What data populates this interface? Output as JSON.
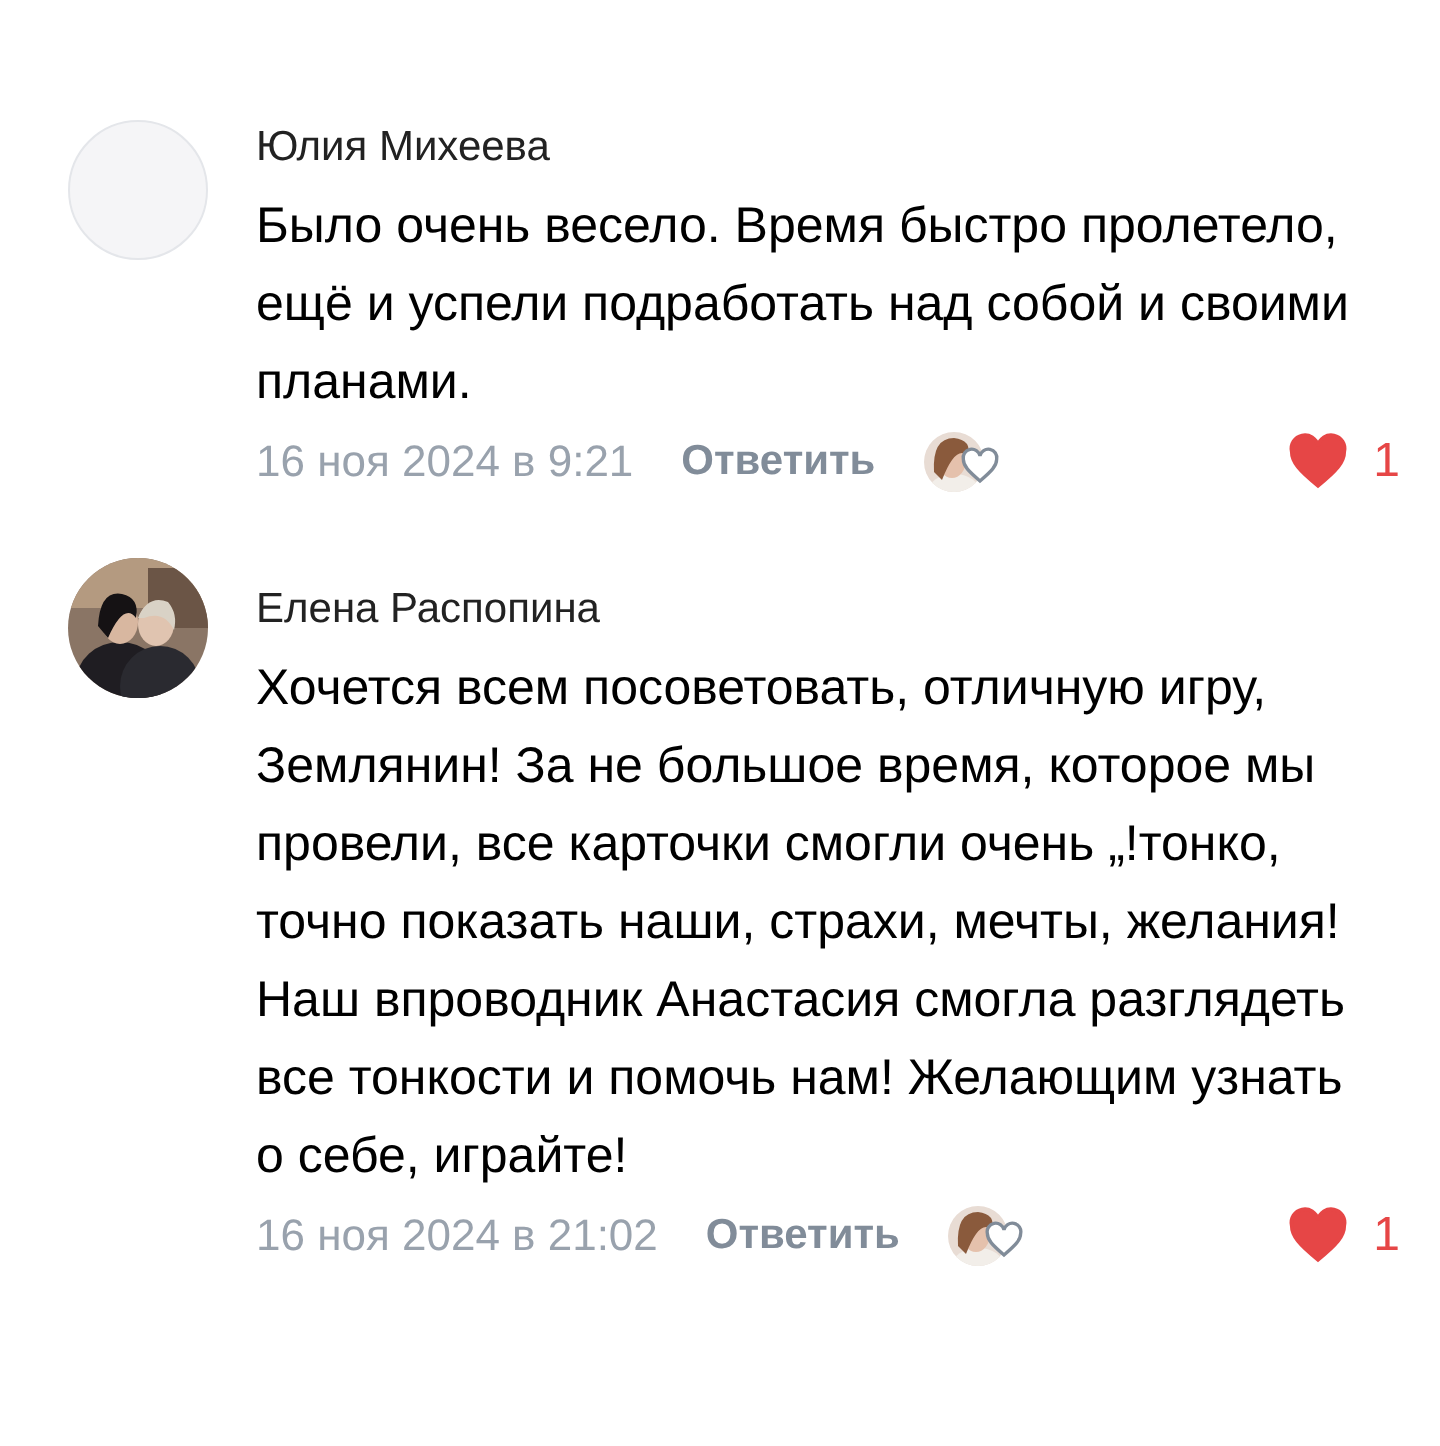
{
  "comments": [
    {
      "author": "Юлия Михеева",
      "avatar": {
        "kind": "empty"
      },
      "text": "Было очень весело. Время быстро пролетело, ещё и успели подработать над собой и своими планами.",
      "date": "16 ноя 2024 в 9:21",
      "reply_label": "Ответить",
      "liked": true,
      "like_count": "1"
    },
    {
      "author": "Елена Распопина",
      "text": "Хочется всем посоветовать, отличную игру, Землянин! За не большое время, которое мы провели, все карточки смогли очень „!тонко, точно показать наши, страхи, мечты, желания! Наш впроводник Анастасия смогла разглядеть все тонкости и помочь нам! Желающим узнать о себе, играйте!",
      "date": "16 ноя 2024 в 21:02",
      "reply_label": "Ответить",
      "liked": true,
      "like_count": "1"
    }
  ]
}
